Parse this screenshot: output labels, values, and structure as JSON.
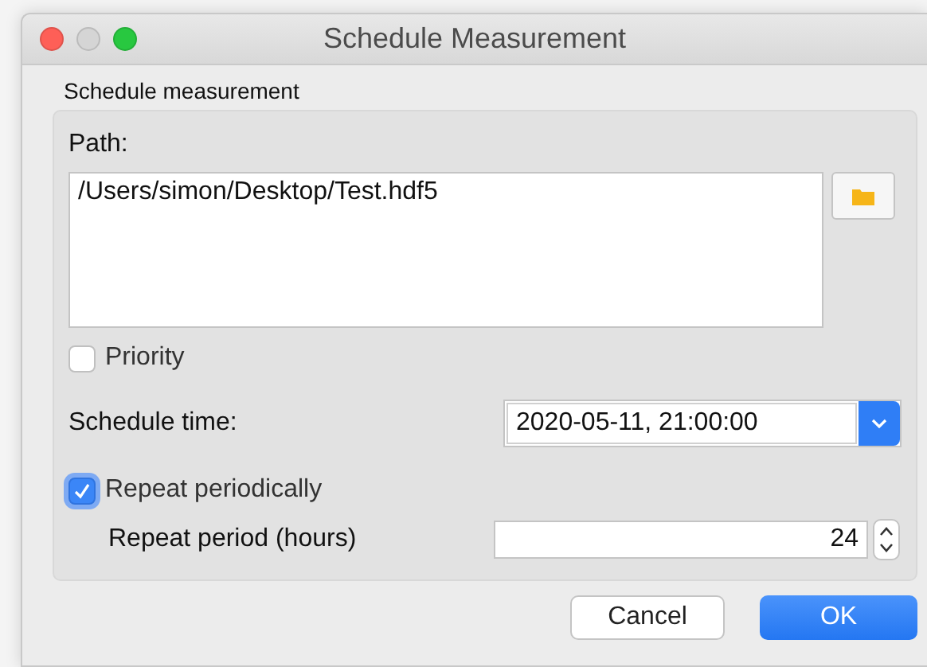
{
  "window": {
    "title": "Schedule Measurement"
  },
  "group": {
    "title": "Schedule measurement"
  },
  "path": {
    "label": "Path:",
    "value": "/Users/simon/Desktop/Test.hdf5"
  },
  "priority": {
    "label": "Priority",
    "checked": false
  },
  "schedule_time": {
    "label": "Schedule time:",
    "value": "2020-05-11, 21:00:00"
  },
  "repeat": {
    "label": "Repeat periodically",
    "checked": true
  },
  "repeat_period": {
    "label": "Repeat period (hours)",
    "value": "24"
  },
  "buttons": [
    {
      "label": "Cancel",
      "kind": "secondary"
    },
    {
      "label": "OK",
      "kind": "primary"
    }
  ]
}
